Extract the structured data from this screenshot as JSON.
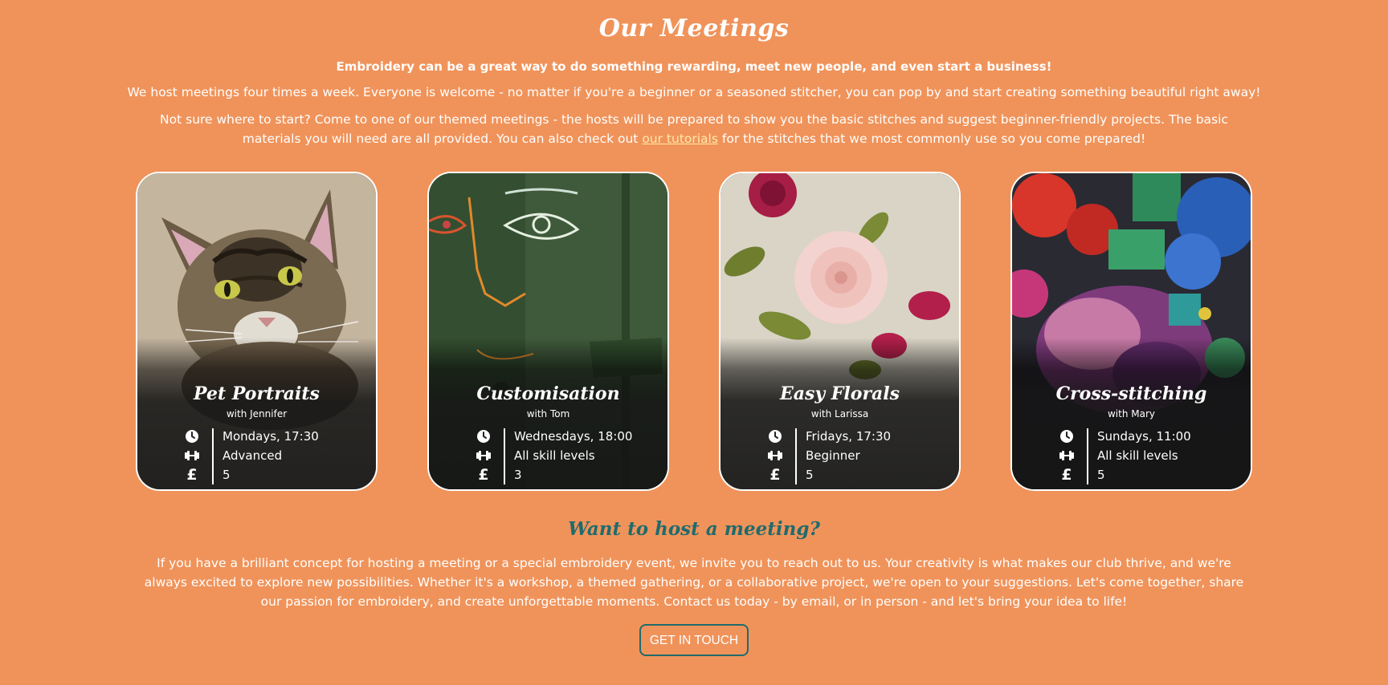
{
  "header": {
    "title": "Our Meetings",
    "intro_bold": "Embroidery can be a great way to do something rewarding, meet new people, and even start a business!",
    "intro_p1": "We host meetings four times a week. Everyone is welcome - no matter if you're a beginner or a seasoned stitcher, you can pop by and start creating something beautiful right away!",
    "intro_p2_before": "Not sure where to start? Come to one of our themed meetings - the hosts will be prepared to show you the basic stitches and suggest beginner-friendly projects. The basic materials you will need are all provided. You can also check out ",
    "intro_p2_link": "our tutorials",
    "intro_p2_after": " for the stitches that we most commonly use so you come prepared!"
  },
  "cards": [
    {
      "title": "Pet Portraits",
      "host": "with Jennifer",
      "time": "Mondays, 17:30",
      "level": "Advanced",
      "price": "5",
      "image": "embroidered-cat-portrait"
    },
    {
      "title": "Customisation",
      "host": "with Tom",
      "time": "Wednesdays, 18:00",
      "level": "All skill levels",
      "price": "3",
      "image": "embroidered-face-on-green-jacket"
    },
    {
      "title": "Easy Florals",
      "host": "with Larissa",
      "time": "Fridays, 17:30",
      "level": "Beginner",
      "price": "5",
      "image": "embroidered-rose-on-linen"
    },
    {
      "title": "Cross-stitching",
      "host": "with Mary",
      "time": "Sundays, 11:00",
      "level": "All skill levels",
      "price": "5",
      "image": "colourful-cross-stitch-flowers"
    }
  ],
  "icons": {
    "time": "clock-icon",
    "level": "dumbbell-icon",
    "price": "pound-icon",
    "price_glyph": "£"
  },
  "host_section": {
    "title": "Want to host a meeting?",
    "text": "If you have a brilliant concept for hosting a meeting or a special embroidery event, we invite you to reach out to us. Your creativity is what makes our club thrive, and we're always excited to explore new possibilities. Whether it's a workshop, a themed gathering, or a collaborative project, we're open to your suggestions. Let's come together, share our passion for embroidery, and create unforgettable moments. Contact us today - by email, or in person - and let's bring your idea to life!",
    "button_label": "GET IN TOUCH"
  },
  "colors": {
    "background": "#f0935a",
    "accent": "#1f6b6d",
    "link": "#ffe9a8",
    "text": "#ffffff"
  }
}
